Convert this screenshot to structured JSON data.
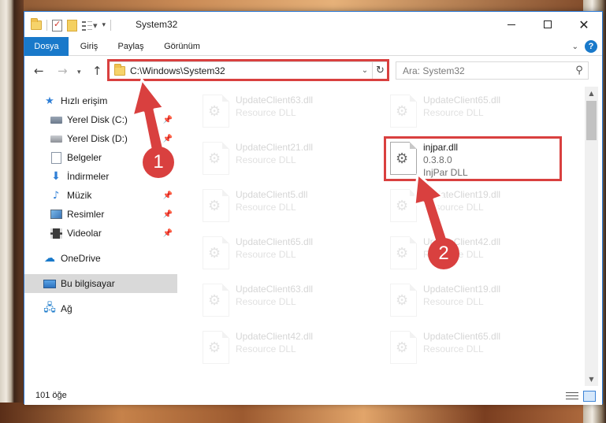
{
  "window": {
    "title": "System32"
  },
  "ribbon": {
    "tabs": [
      "Dosya",
      "Giriş",
      "Paylaş",
      "Görünüm"
    ]
  },
  "address": {
    "path": "C:\\Windows\\System32"
  },
  "search": {
    "placeholder": "Ara: System32"
  },
  "sidebar": {
    "items": [
      {
        "label": "Hızlı erişim",
        "icon": "star-icon"
      },
      {
        "label": "Yerel Disk (C:)",
        "icon": "drive-icon"
      },
      {
        "label": "Yerel Disk (D:)",
        "icon": "drive-icon"
      },
      {
        "label": "Belgeler",
        "icon": "documents-icon"
      },
      {
        "label": "İndirmeler",
        "icon": "download-icon"
      },
      {
        "label": "Müzik",
        "icon": "music-icon"
      },
      {
        "label": "Resimler",
        "icon": "pictures-icon"
      },
      {
        "label": "Videolar",
        "icon": "videos-icon"
      },
      {
        "label": "OneDrive",
        "icon": "cloud-icon"
      },
      {
        "label": "Bu bilgisayar",
        "icon": "computer-icon"
      },
      {
        "label": "Ağ",
        "icon": "network-icon"
      }
    ],
    "selected": "Bu bilgisayar"
  },
  "files": [
    {
      "name": "UpdateClient63.dll",
      "desc": "Resource DLL"
    },
    {
      "name": "UpdateClient65.dll",
      "desc": "Resource DLL"
    },
    {
      "name": "UpdateClient21.dll",
      "desc": "Resource DLL"
    },
    {
      "name": "injpar.dll",
      "version": "0.3.8.0",
      "desc": "InjPar DLL"
    },
    {
      "name": "UpdateClient5.dll",
      "desc": "Resource DLL"
    },
    {
      "name": "UpdateClient19.dll",
      "desc": "Resource DLL"
    },
    {
      "name": "UpdateClient65.dll",
      "desc": "Resource DLL"
    },
    {
      "name": "UpdateClient42.dll",
      "desc": "Resource DLL"
    },
    {
      "name": "UpdateClient63.dll",
      "desc": "Resource DLL"
    },
    {
      "name": "UpdateClient19.dll",
      "desc": "Resource DLL"
    },
    {
      "name": "UpdateClient42.dll",
      "desc": "Resource DLL"
    },
    {
      "name": "UpdateClient65.dll",
      "desc": "Resource DLL"
    }
  ],
  "status": {
    "count": "101 öğe"
  },
  "callouts": [
    "1",
    "2"
  ],
  "colors": {
    "accent": "#1979ca",
    "highlight": "#d9403f"
  }
}
